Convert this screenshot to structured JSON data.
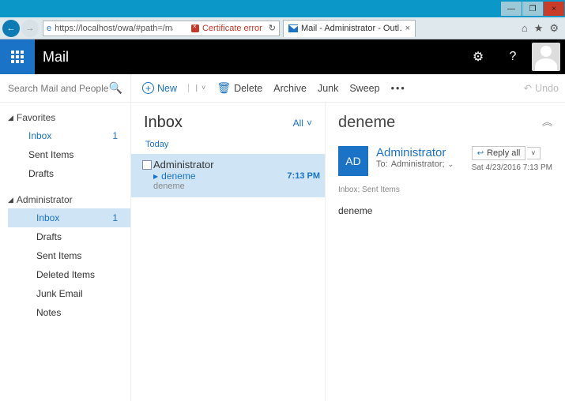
{
  "window": {
    "min": "—",
    "max": "❐",
    "close": "×"
  },
  "browser": {
    "url": "https://localhost/owa/#path=/mail",
    "cert_error": "Certificate error",
    "tab_title": "Mail - Administrator - Outl…",
    "tab_close": "×",
    "home": "⌂",
    "fav": "★",
    "gear": "⚙"
  },
  "suite": {
    "app": "Mail",
    "gear": "⚙",
    "help": "?"
  },
  "sidebar": {
    "search_placeholder": "Search Mail and People",
    "favorites_label": "Favorites",
    "fav_items": [
      {
        "label": "Inbox",
        "badge": "1",
        "link": true
      },
      {
        "label": "Sent Items"
      },
      {
        "label": "Drafts"
      }
    ],
    "account_label": "Administrator",
    "acct_items": [
      {
        "label": "Inbox",
        "badge": "1",
        "active": true
      },
      {
        "label": "Drafts"
      },
      {
        "label": "Sent Items"
      },
      {
        "label": "Deleted Items"
      },
      {
        "label": "Junk Email"
      },
      {
        "label": "Notes"
      }
    ]
  },
  "toolbar": {
    "new": "New",
    "delete": "Delete",
    "archive": "Archive",
    "junk": "Junk",
    "sweep": "Sweep",
    "more": "•••",
    "undo": "Undo"
  },
  "list": {
    "folder": "Inbox",
    "filter": "All",
    "date_group": "Today",
    "messages": [
      {
        "from": "Administrator",
        "subject": "deneme",
        "time": "7:13 PM",
        "preview": "deneme"
      }
    ]
  },
  "reading": {
    "subject": "deneme",
    "initials": "AD",
    "sender": "Administrator",
    "to_label": "To:",
    "to": "Administrator;",
    "reply": "Reply all",
    "date": "Sat 4/23/2016 7:13 PM",
    "tags": "Inbox; Sent Items",
    "body": "deneme"
  }
}
